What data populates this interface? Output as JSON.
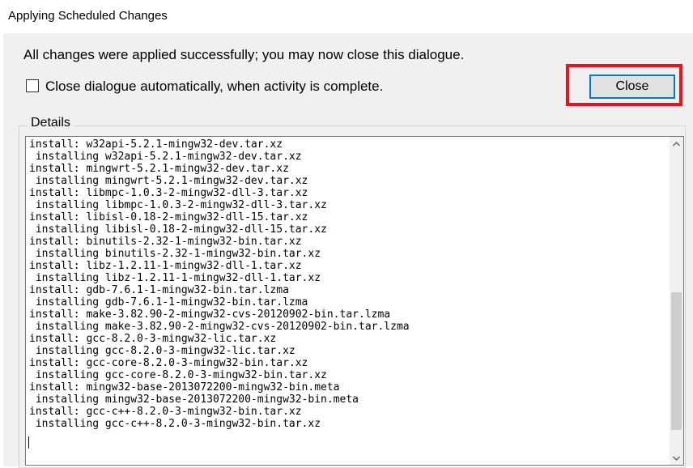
{
  "window": {
    "title": "Applying Scheduled Changes"
  },
  "message": "All changes were applied successfully; you may now close this dialogue.",
  "auto_close": {
    "label": "Close dialogue automatically, when activity is complete.",
    "checked": false
  },
  "close_button": {
    "label": "Close"
  },
  "details": {
    "label": "Details",
    "lines": [
      "install: w32api-5.2.1-mingw32-dev.tar.xz",
      " installing w32api-5.2.1-mingw32-dev.tar.xz",
      "install: mingwrt-5.2.1-mingw32-dev.tar.xz",
      " installing mingwrt-5.2.1-mingw32-dev.tar.xz",
      "install: libmpc-1.0.3-2-mingw32-dll-3.tar.xz",
      " installing libmpc-1.0.3-2-mingw32-dll-3.tar.xz",
      "install: libisl-0.18-2-mingw32-dll-15.tar.xz",
      " installing libisl-0.18-2-mingw32-dll-15.tar.xz",
      "install: binutils-2.32-1-mingw32-bin.tar.xz",
      " installing binutils-2.32-1-mingw32-bin.tar.xz",
      "install: libz-1.2.11-1-mingw32-dll-1.tar.xz",
      " installing libz-1.2.11-1-mingw32-dll-1.tar.xz",
      "install: gdb-7.6.1-1-mingw32-bin.tar.lzma",
      " installing gdb-7.6.1-1-mingw32-bin.tar.lzma",
      "install: make-3.82.90-2-mingw32-cvs-20120902-bin.tar.lzma",
      " installing make-3.82.90-2-mingw32-cvs-20120902-bin.tar.lzma",
      "install: gcc-8.2.0-3-mingw32-lic.tar.xz",
      " installing gcc-8.2.0-3-mingw32-lic.tar.xz",
      "install: gcc-core-8.2.0-3-mingw32-bin.tar.xz",
      " installing gcc-core-8.2.0-3-mingw32-bin.tar.xz",
      "install: mingw32-base-2013072200-mingw32-bin.meta",
      " installing mingw32-base-2013072200-mingw32-bin.meta",
      "install: gcc-c++-8.2.0-3-mingw32-bin.tar.xz",
      " installing gcc-c++-8.2.0-3-mingw32-bin.tar.xz"
    ]
  },
  "scrollbar": {
    "up_icon": "chevron-up",
    "down_icon": "chevron-down"
  },
  "colors": {
    "highlight": "#e8141c",
    "button_focus": "#0078d7"
  }
}
